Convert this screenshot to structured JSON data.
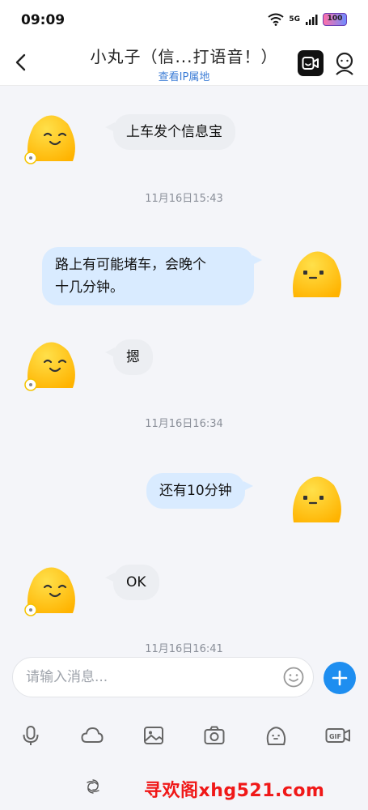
{
  "status_bar": {
    "time": "09:09",
    "network": "5G",
    "battery": "100"
  },
  "header": {
    "title": "小丸子（信...打语音！）",
    "subtitle": "查看IP属地",
    "back_icon": "chevron-left-icon",
    "video_icon": "video-call-icon",
    "profile_icon": "profile-icon"
  },
  "messages": [
    {
      "side": "left",
      "text": "上车发个信息宝"
    },
    {
      "timestamp": "11月16日15:43"
    },
    {
      "side": "right",
      "text_line1": "路上有可能堵车，会晚个",
      "text_line2": "十几分钟。"
    },
    {
      "side": "left",
      "text": "摁"
    },
    {
      "timestamp": "11月16日16:34"
    },
    {
      "side": "right",
      "text": "还有10分钟"
    },
    {
      "side": "left",
      "text": "OK"
    },
    {
      "timestamp": "11月16日16:41"
    }
  ],
  "input": {
    "placeholder": "请输入消息..."
  },
  "toolbar": {
    "items": [
      "microphone-icon",
      "cloud-icon",
      "image-icon",
      "camera-icon",
      "sticker-icon",
      "gif-icon"
    ],
    "gif_label": "GIF"
  },
  "watermark": "寻欢阁xhg521.com",
  "colors": {
    "accent": "#1e8ef0",
    "link": "#3b7cd6",
    "bubble_right": "#d9ebff",
    "bubble_left": "#eceef2",
    "avatar": "#ffc51a"
  }
}
